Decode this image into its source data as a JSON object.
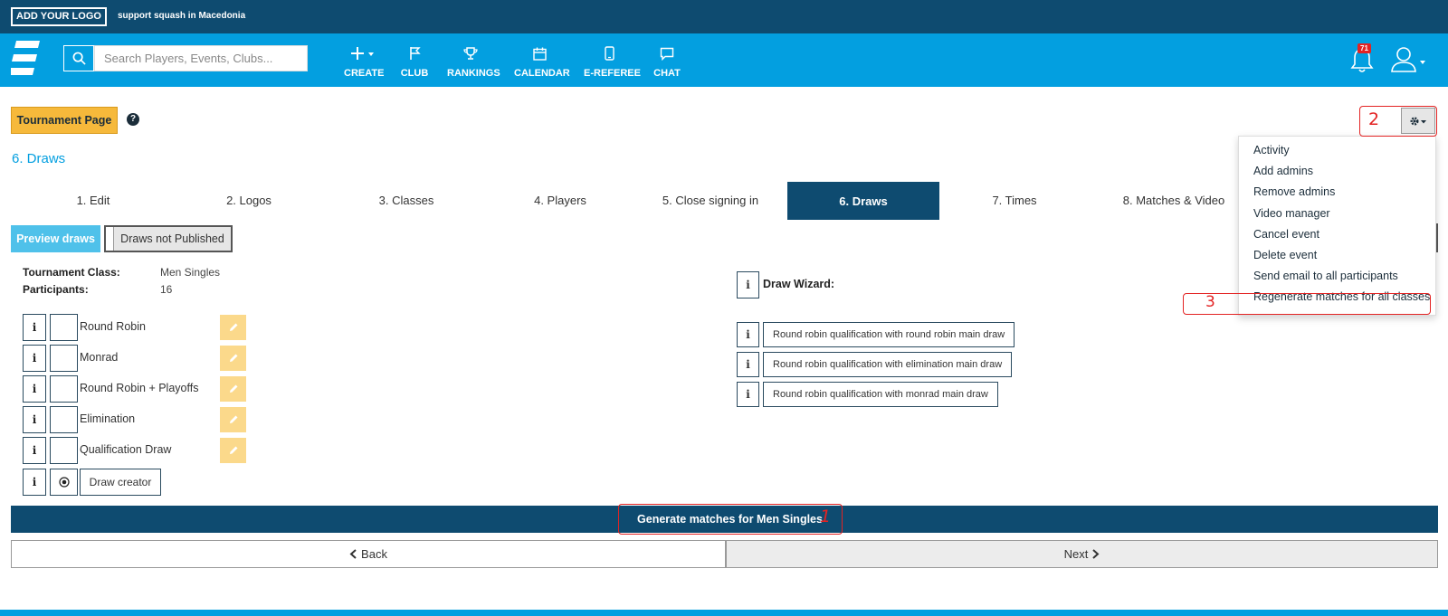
{
  "topbar": {
    "logo_text": "ADD YOUR LOGO",
    "tagline": "support squash in Macedonia"
  },
  "navbar": {
    "search_placeholder": "Search Players, Events, Clubs...",
    "items": [
      {
        "label": "CREATE",
        "icon": "plus-icon"
      },
      {
        "label": "CLUB",
        "icon": "flag-icon"
      },
      {
        "label": "RANKINGS",
        "icon": "trophy-icon"
      },
      {
        "label": "CALENDAR",
        "icon": "calendar-icon"
      },
      {
        "label": "E-REFEREE",
        "icon": "mobile-icon"
      },
      {
        "label": "CHAT",
        "icon": "chat-icon"
      }
    ],
    "notification_count": "71"
  },
  "page": {
    "tournament_button": "Tournament Page",
    "section_title": "6. Draws",
    "tabs": [
      {
        "label": "1. Edit",
        "active": false
      },
      {
        "label": "2. Logos",
        "active": false
      },
      {
        "label": "3. Classes",
        "active": false
      },
      {
        "label": "4. Players",
        "active": false
      },
      {
        "label": "5. Close signing in",
        "active": false
      },
      {
        "label": "6. Draws",
        "active": true
      },
      {
        "label": "7. Times",
        "active": false
      },
      {
        "label": "8. Matches & Video",
        "active": false
      }
    ],
    "preview_button": "Preview draws",
    "publish_status": "Draws not Published"
  },
  "class_info": {
    "class_label": "Tournament Class:",
    "class_value": "Men Singles",
    "participants_label": "Participants:",
    "participants_value": "16"
  },
  "draw_types": [
    {
      "label": "Round Robin"
    },
    {
      "label": "Monrad"
    },
    {
      "label": "Round Robin + Playoffs"
    },
    {
      "label": "Elimination"
    },
    {
      "label": "Qualification Draw"
    }
  ],
  "draw_creator_label": "Draw creator",
  "info_glyph": "i",
  "wizard": {
    "title": "Draw Wizard:",
    "options": [
      "Round robin qualification with round robin main draw",
      "Round robin qualification with elimination main draw",
      "Round robin qualification with monrad main draw"
    ]
  },
  "actions": {
    "generate": "Generate matches for Men Singles",
    "back": "Back",
    "next": "Next"
  },
  "settings_menu": {
    "items": [
      "Activity",
      "Add admins",
      "Remove admins",
      "Video manager",
      "Cancel event",
      "Delete event",
      "Send email to all participants",
      "Regenerate matches for all classes"
    ]
  },
  "annotations": {
    "one": "1",
    "two": "2",
    "three": "3"
  },
  "colors": {
    "topbar": "#0e4b70",
    "navbar": "#039fe0",
    "accent_yellow": "#f6b93b",
    "annotation_red": "#e32323"
  }
}
